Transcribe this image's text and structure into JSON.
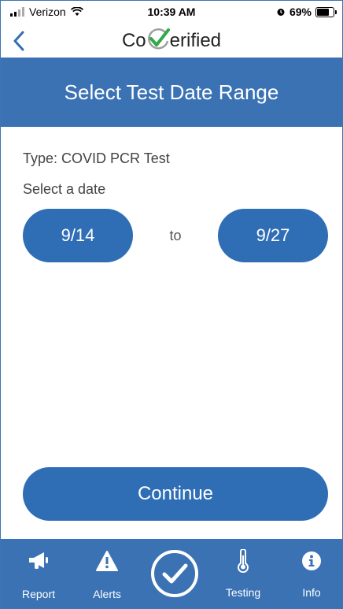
{
  "status_bar": {
    "carrier": "Verizon",
    "time": "10:39 AM",
    "battery": "69%",
    "battery_level": 0.69
  },
  "nav": {
    "back_icon": "chevron-left-icon",
    "logo_prefix": "Co",
    "logo_suffix": "erified"
  },
  "banner": {
    "title": "Select Test Date Range"
  },
  "form": {
    "type_line": "Type: COVID  PCR Test",
    "select_label": "Select a date",
    "from_date": "9/14",
    "to_label": "to",
    "to_date": "9/27",
    "continue_label": "Continue"
  },
  "tabs": [
    {
      "label": "Report",
      "icon": "megaphone-icon"
    },
    {
      "label": "Alerts",
      "icon": "warning-icon"
    },
    {
      "label": "",
      "icon": "check-circle-icon"
    },
    {
      "label": "Testing",
      "icon": "thermometer-icon"
    },
    {
      "label": "Info",
      "icon": "info-icon"
    }
  ],
  "colors": {
    "primary": "#3a72b4",
    "button": "#2f6eb5",
    "logo_check": "#2eaa4a"
  }
}
